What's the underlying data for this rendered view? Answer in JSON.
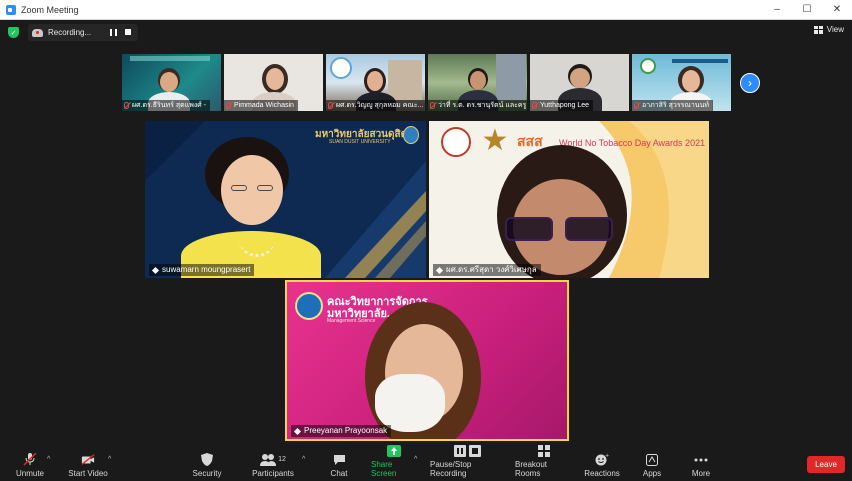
{
  "window": {
    "title": "Zoom Meeting",
    "controls": {
      "minimize": "–",
      "maximize": "☐",
      "close": "✕"
    }
  },
  "recording": {
    "label": "Recording..."
  },
  "view": {
    "label": "View"
  },
  "thumbnails": [
    {
      "name": "ผศ.ดร.ธีรินทร์ สุดแพงศ์ -"
    },
    {
      "name": "Pimmada Wichasin"
    },
    {
      "name": "ผศ.ดร.วิญญู สุกุลหอม คณะ..."
    },
    {
      "name": "ว่าที่ ร.ต. ดร.ชานุรัตน์ และครู..."
    },
    {
      "name": "Yutthapong Lee"
    },
    {
      "name": "อาภาสิริ สุวรรณานนท์"
    }
  ],
  "tiles": {
    "top_left": {
      "name": "suwamarn moungprasert",
      "banner_thai": "มหาวิทยาลัยสวนดุสิต",
      "banner_en": "SUAN DUSIT UNIVERSITY"
    },
    "top_right": {
      "name": "ผศ.ดร.ศรีสุดา วงศ์วิเศษกุล",
      "banner_org": "สสส",
      "banner_event": "World No Tobacco Day Awards 2021"
    },
    "bottom": {
      "name": "Preeyanan Prayoonsak",
      "banner_line1": "คณะวิทยาการจัดการ",
      "banner_line2": "มหาวิทยาลัย...",
      "banner_sub": "Management Science"
    }
  },
  "toolbar": {
    "unmute": "Unmute",
    "start_video": "Start Video",
    "security": "Security",
    "participants": "Participants",
    "participants_count": "12",
    "chat": "Chat",
    "share_screen": "Share Screen",
    "pause_stop_recording": "Pause/Stop Recording",
    "breakout_rooms": "Breakout Rooms",
    "reactions": "Reactions",
    "apps": "Apps",
    "more": "More",
    "leave": "Leave"
  },
  "colors": {
    "accent": "#2D8CFF",
    "share_green": "#22c55e",
    "leave_red": "#e02828",
    "active_speaker": "#f5d63d"
  }
}
